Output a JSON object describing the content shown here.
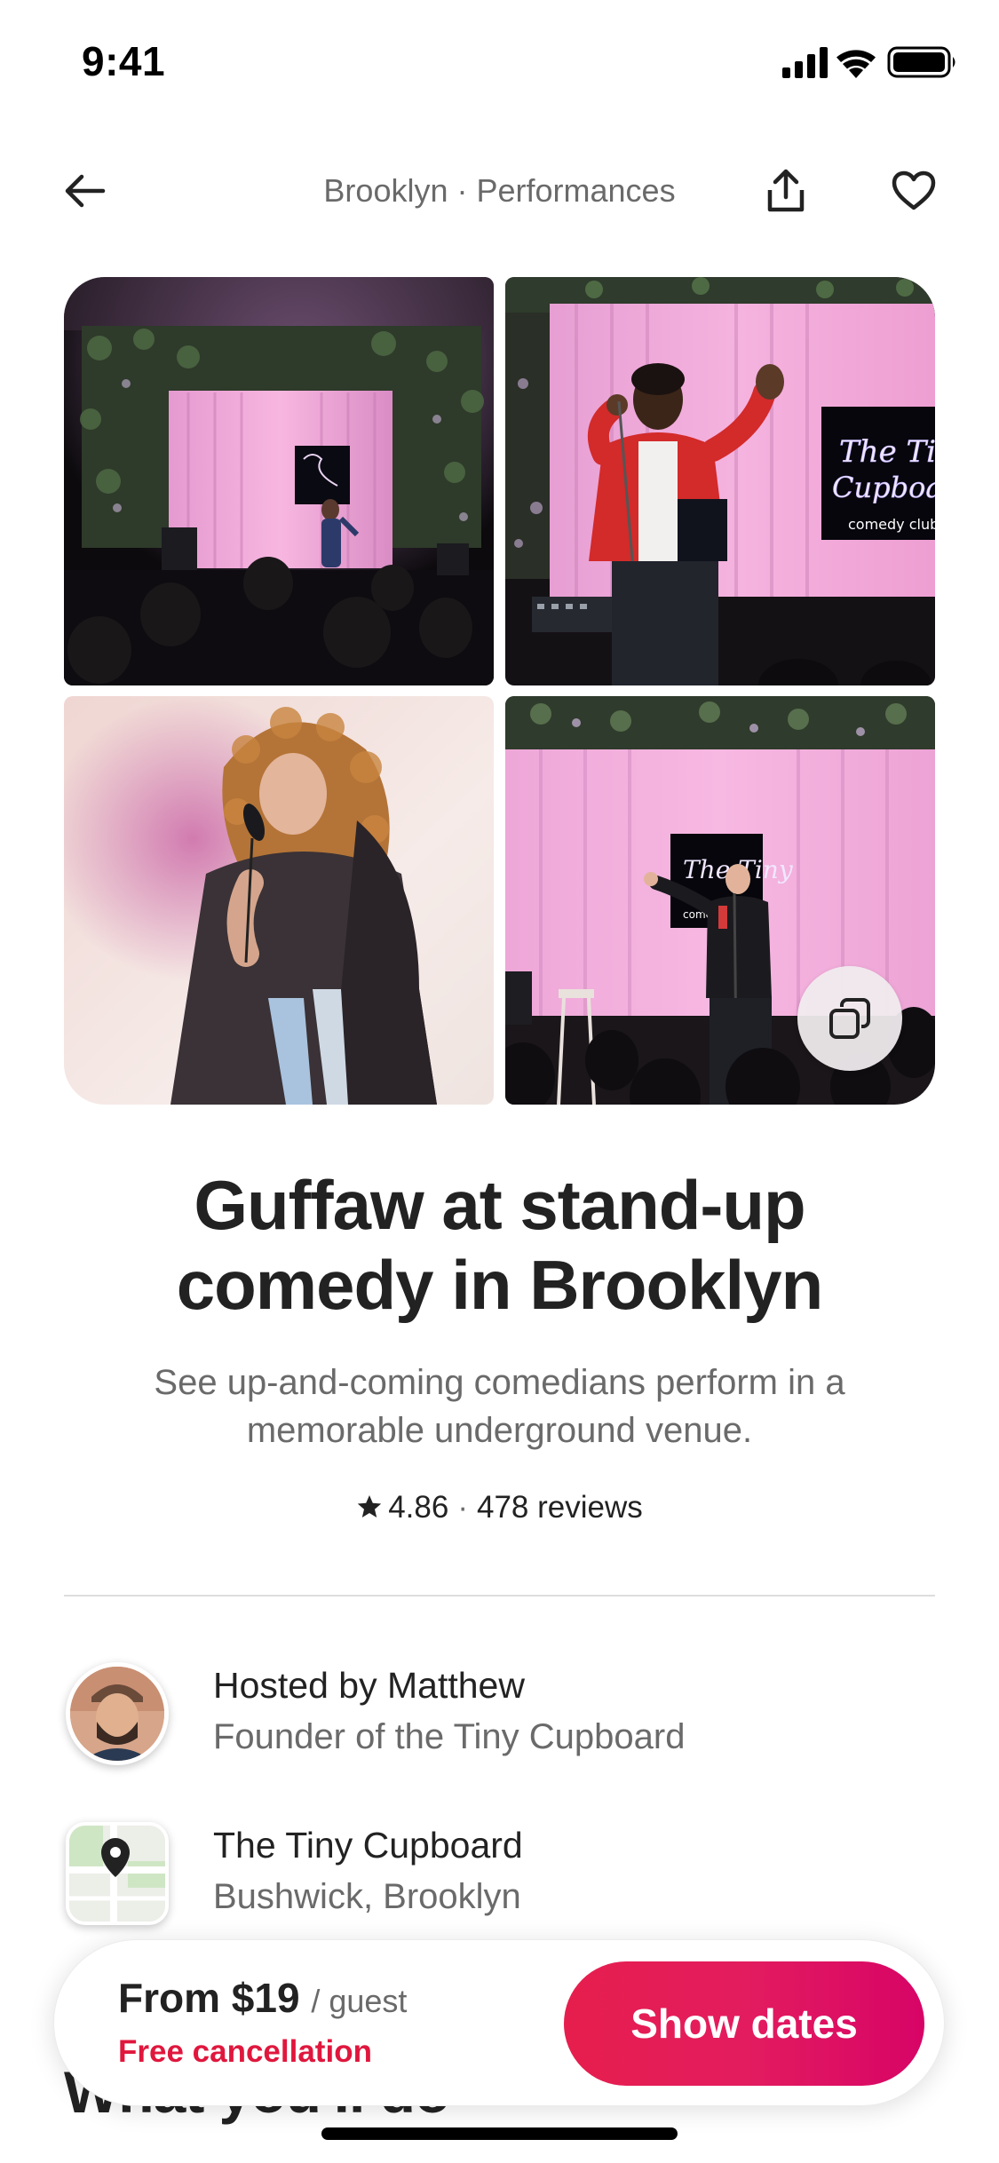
{
  "status_bar": {
    "time": "9:41"
  },
  "nav": {
    "title": "Brooklyn · Performances",
    "back_icon": "arrow-left-icon",
    "share_icon": "share-icon",
    "favorite_icon": "heart-icon"
  },
  "gallery": {
    "photos": [
      {
        "alt": "Comedian performing on stage with pink curtain"
      },
      {
        "alt": "Comedian in red jacket with The Tiny Cupboard neon sign"
      },
      {
        "alt": "Comedian with curly hair holding microphone"
      },
      {
        "alt": "Comedian on stage in front of audience"
      }
    ],
    "neon_sign_text": "The Tiny Cupboard",
    "neon_sign_subtext": "comedy club",
    "show_all_icon": "copy-stack-icon"
  },
  "listing": {
    "title": "Guffaw at stand-up comedy in Brooklyn",
    "description": "See up-and-coming comedians perform in a memorable underground venue.",
    "rating": "4.86",
    "reviews": "478 reviews",
    "separator": "·"
  },
  "host": {
    "name": "Hosted by Matthew",
    "role": "Founder of the Tiny Cupboard"
  },
  "venue": {
    "name": "The Tiny Cupboard",
    "location": "Bushwick, Brooklyn"
  },
  "next_section": {
    "heading": "What you'll do"
  },
  "booking": {
    "price": "From $19",
    "price_unit": "/ guest",
    "cancellation": "Free cancellation",
    "button_label": "Show dates"
  },
  "colors": {
    "brand": "#E31C5F",
    "text_primary": "#222222",
    "text_secondary": "#6A6A6A",
    "curtain_pink": "#F3A6D6"
  }
}
